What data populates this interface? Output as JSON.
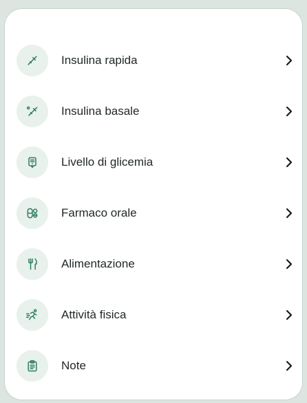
{
  "menu": {
    "items": [
      {
        "label": "Insulina rapida",
        "icon": "syringe-fast-icon"
      },
      {
        "label": "Insulina basale",
        "icon": "syringe-basal-icon"
      },
      {
        "label": "Livello di glicemia",
        "icon": "glucose-meter-icon"
      },
      {
        "label": "Farmaco orale",
        "icon": "pills-icon"
      },
      {
        "label": "Alimentazione",
        "icon": "fork-knife-icon"
      },
      {
        "label": "Attività fisica",
        "icon": "running-icon"
      },
      {
        "label": "Note",
        "icon": "clipboard-icon"
      }
    ]
  },
  "colors": {
    "accent": "#2f7e5f",
    "icon_bg": "#e8f1ec",
    "text": "#1f2724",
    "chevron": "#1a1a1a"
  }
}
